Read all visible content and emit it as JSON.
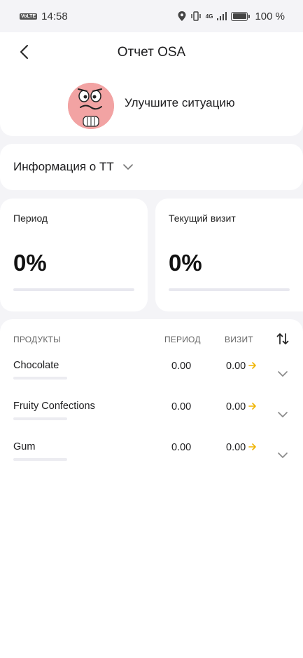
{
  "status_bar": {
    "time": "14:58",
    "volte": "VoLTE",
    "network": "4G",
    "battery": "100 %"
  },
  "header": {
    "title": "Отчет OSA",
    "mood_text": "Улучшите ситуацию"
  },
  "info": {
    "label": "Информация о ТТ"
  },
  "metrics": [
    {
      "label": "Период",
      "value": "0%",
      "progress": 0
    },
    {
      "label": "Текущий визит",
      "value": "0%",
      "progress": 0
    }
  ],
  "products": {
    "headers": {
      "name": "ПРОДУКТЫ",
      "period": "ПЕРИОД",
      "visit": "ВИЗИТ"
    },
    "rows": [
      {
        "name": "Chocolate",
        "period": "0.00",
        "visit": "0.00"
      },
      {
        "name": "Fruity Confections",
        "period": "0.00",
        "visit": "0.00"
      },
      {
        "name": "Gum",
        "period": "0.00",
        "visit": "0.00"
      }
    ]
  },
  "colors": {
    "background": "#f4f4f7",
    "card": "#ffffff",
    "mascot": "#f2a3a3",
    "arrow_accent": "#f0b400",
    "track": "#e8e8ef"
  },
  "icons": [
    "back-arrow-icon",
    "chevron-down-icon",
    "sort-icon",
    "arrow-right-icon",
    "location-icon",
    "vibrate-icon",
    "signal-icon",
    "battery-icon"
  ]
}
